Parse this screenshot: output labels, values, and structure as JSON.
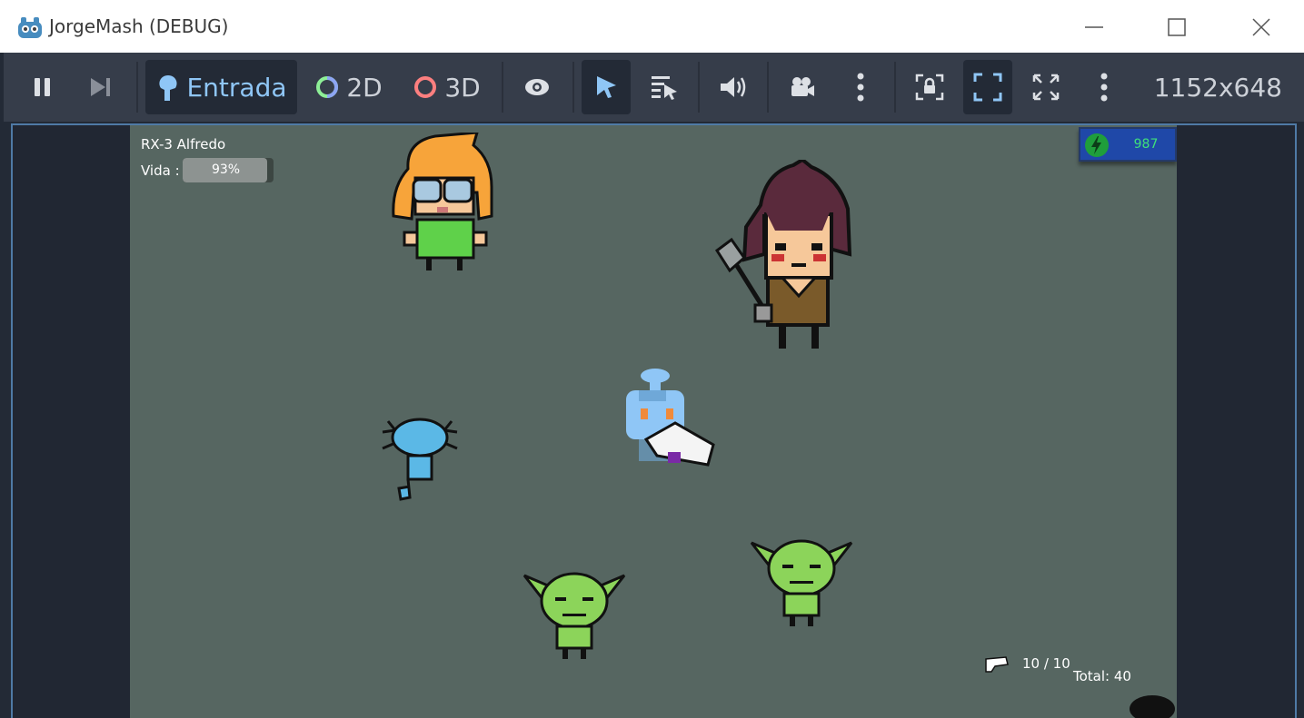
{
  "window": {
    "title": "JorgeMash (DEBUG)"
  },
  "toolbar": {
    "input_label": "Entrada",
    "label_2d": "2D",
    "label_3d": "3D",
    "resolution": "1152x648"
  },
  "hud": {
    "player_name": "RX-3 Alfredo",
    "vida_label": "Vida :",
    "vida_percent": 93,
    "vida_text": "93%",
    "coins": "987",
    "ammo": "10 / 10",
    "ammo_total": "Total: 40"
  },
  "colors": {
    "accent": "#8fc6f6",
    "game_bg": "#566661",
    "coin_bg": "#1f48a8",
    "coin_text": "#3fe07a"
  }
}
